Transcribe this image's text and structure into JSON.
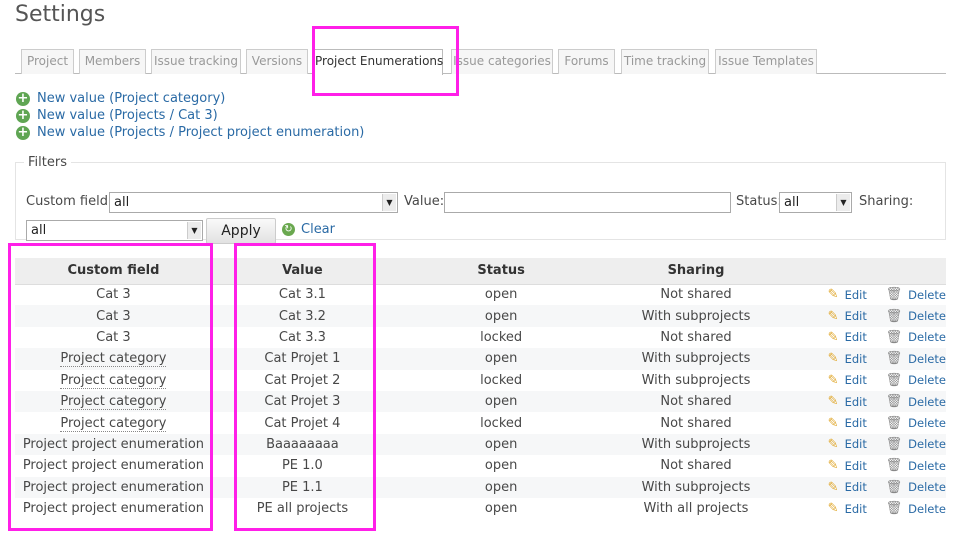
{
  "page": {
    "title": "Settings"
  },
  "tabs": [
    {
      "label": "Project",
      "selected": false
    },
    {
      "label": "Members",
      "selected": false
    },
    {
      "label": "Issue tracking",
      "selected": false
    },
    {
      "label": "Versions",
      "selected": false
    },
    {
      "label": "Project Enumerations",
      "selected": true
    },
    {
      "label": "Issue categories",
      "selected": false
    },
    {
      "label": "Forums",
      "selected": false
    },
    {
      "label": "Time tracking",
      "selected": false
    },
    {
      "label": "Issue Templates",
      "selected": false
    }
  ],
  "new_links": [
    "New value (Project category)",
    "New value (Projects / Cat 3)",
    "New value (Projects / Project project enumeration)"
  ],
  "filters": {
    "legend": "Filters",
    "custom_field_label": "Custom field:",
    "custom_field_value": "all",
    "value_label": "Value:",
    "value_input": "",
    "status_label": "Status:",
    "status_value": "all",
    "sharing_label": "Sharing:",
    "sharing_value": "all",
    "apply_label": "Apply",
    "clear_label": "Clear"
  },
  "table": {
    "headers": {
      "custom_field": "Custom field",
      "value": "Value",
      "status": "Status",
      "sharing": "Sharing"
    },
    "edit_label": "Edit",
    "delete_label": "Delete",
    "rows": [
      {
        "custom_field": "Cat 3",
        "value": "Cat 3.1",
        "status": "open",
        "sharing": "Not shared"
      },
      {
        "custom_field": "Cat 3",
        "value": "Cat 3.2",
        "status": "open",
        "sharing": "With subprojects"
      },
      {
        "custom_field": "Cat 3",
        "value": "Cat 3.3",
        "status": "locked",
        "sharing": "Not shared"
      },
      {
        "custom_field": "Project category",
        "value": "Cat Projet 1",
        "status": "open",
        "sharing": "With subprojects"
      },
      {
        "custom_field": "Project category",
        "value": "Cat Projet 2",
        "status": "locked",
        "sharing": "With subprojects"
      },
      {
        "custom_field": "Project category",
        "value": "Cat Projet 3",
        "status": "open",
        "sharing": "Not shared"
      },
      {
        "custom_field": "Project category",
        "value": "Cat Projet 4",
        "status": "locked",
        "sharing": "Not shared"
      },
      {
        "custom_field": "Project project enumeration",
        "value": "Baaaaaaaa",
        "status": "open",
        "sharing": "With subprojects"
      },
      {
        "custom_field": "Project project enumeration",
        "value": "PE 1.0",
        "status": "open",
        "sharing": "Not shared"
      },
      {
        "custom_field": "Project project enumeration",
        "value": "PE 1.1",
        "status": "open",
        "sharing": "With subprojects"
      },
      {
        "custom_field": "Project project enumeration",
        "value": "PE all projects",
        "status": "open",
        "sharing": "With all projects"
      }
    ]
  },
  "icons": {
    "add": "add-icon",
    "clear": "reload-icon",
    "edit": "pencil-icon",
    "delete": "trash-icon"
  },
  "colors": {
    "link": "#2a6aa5",
    "highlight": "#ff1fe8",
    "add_icon": "#5fa553"
  }
}
